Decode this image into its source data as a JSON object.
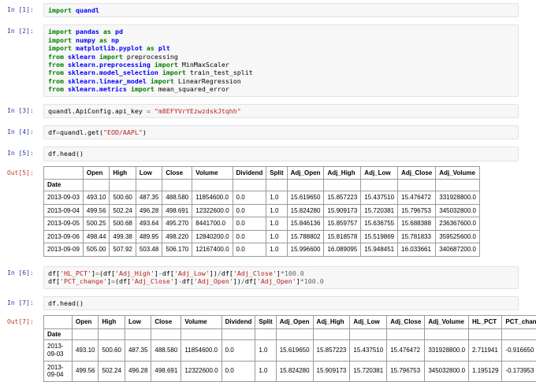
{
  "colors": {
    "in_prompt": "#303F9F",
    "out_prompt": "#C0392B",
    "keyword": "#008000",
    "module": "#0000FF",
    "string": "#BA2121",
    "operator": "#666666",
    "cell_background": "#F7F7F7",
    "table_border": "#9B9B9B"
  },
  "cells": [
    {
      "prompt": "In [1]:",
      "lines": [
        [
          [
            "k",
            "import"
          ],
          [
            "t",
            " "
          ],
          [
            "nn",
            "quandl"
          ]
        ]
      ]
    },
    {
      "prompt": "In [2]:",
      "lines": [
        [
          [
            "k",
            "import"
          ],
          [
            "t",
            " "
          ],
          [
            "nn",
            "pandas"
          ],
          [
            "t",
            " "
          ],
          [
            "k",
            "as"
          ],
          [
            "t",
            " "
          ],
          [
            "nn",
            "pd"
          ]
        ],
        [
          [
            "k",
            "import"
          ],
          [
            "t",
            " "
          ],
          [
            "nn",
            "numpy"
          ],
          [
            "t",
            " "
          ],
          [
            "k",
            "as"
          ],
          [
            "t",
            " "
          ],
          [
            "nn",
            "np"
          ]
        ],
        [
          [
            "k",
            "import"
          ],
          [
            "t",
            " "
          ],
          [
            "nn",
            "matplotlib.pyplot"
          ],
          [
            "t",
            " "
          ],
          [
            "k",
            "as"
          ],
          [
            "t",
            " "
          ],
          [
            "nn",
            "plt"
          ]
        ],
        [
          [
            "k",
            "from"
          ],
          [
            "t",
            " "
          ],
          [
            "nn",
            "sklearn"
          ],
          [
            "t",
            " "
          ],
          [
            "k",
            "import"
          ],
          [
            "t",
            " preprocessing"
          ]
        ],
        [
          [
            "k",
            "from"
          ],
          [
            "t",
            " "
          ],
          [
            "nn",
            "sklearn.preprocessing"
          ],
          [
            "t",
            " "
          ],
          [
            "k",
            "import"
          ],
          [
            "t",
            " MinMaxScaler"
          ]
        ],
        [
          [
            "k",
            "from"
          ],
          [
            "t",
            " "
          ],
          [
            "nn",
            "sklearn.model_selection"
          ],
          [
            "t",
            " "
          ],
          [
            "k",
            "import"
          ],
          [
            "t",
            " train_test_split"
          ]
        ],
        [
          [
            "k",
            "from"
          ],
          [
            "t",
            " "
          ],
          [
            "nn",
            "sklearn.linear_model"
          ],
          [
            "t",
            " "
          ],
          [
            "k",
            "import"
          ],
          [
            "t",
            " LinearRegression"
          ]
        ],
        [
          [
            "k",
            "from"
          ],
          [
            "t",
            " "
          ],
          [
            "nn",
            "sklearn.metrics"
          ],
          [
            "t",
            " "
          ],
          [
            "k",
            "import"
          ],
          [
            "t",
            " mean_squared_error"
          ]
        ]
      ]
    },
    {
      "prompt": "In [3]:",
      "lines": [
        [
          [
            "t",
            "quandl.ApiConfig.api_key "
          ],
          [
            "o",
            "="
          ],
          [
            "t",
            " "
          ],
          [
            "s",
            "\"m8EFYVrYEzwzdskJtqhh\""
          ]
        ]
      ]
    },
    {
      "prompt": "In [4]:",
      "lines": [
        [
          [
            "t",
            "df"
          ],
          [
            "o",
            "="
          ],
          [
            "t",
            "quandl.get("
          ],
          [
            "s",
            "\"EOD/AAPL\""
          ],
          [
            "t",
            ")"
          ]
        ]
      ]
    },
    {
      "prompt": "In [5]:",
      "lines": [
        [
          [
            "t",
            "df.head()"
          ]
        ]
      ]
    },
    {
      "prompt": "In [6]:",
      "lines": [
        [
          [
            "t",
            "df["
          ],
          [
            "s",
            "'HL_PCT'"
          ],
          [
            "t",
            "]"
          ],
          [
            "o",
            "="
          ],
          [
            "t",
            "(df["
          ],
          [
            "s",
            "'Adj_High'"
          ],
          [
            "t",
            "]"
          ],
          [
            "o",
            "-"
          ],
          [
            "t",
            "df["
          ],
          [
            "s",
            "'Adj_Low'"
          ],
          [
            "t",
            "])"
          ],
          [
            "o",
            "/"
          ],
          [
            "t",
            "df["
          ],
          [
            "s",
            "'Adj_Close'"
          ],
          [
            "t",
            "]"
          ],
          [
            "o",
            "*"
          ],
          [
            "m",
            "100.0"
          ]
        ],
        [
          [
            "t",
            "df["
          ],
          [
            "s",
            "'PCT_change'"
          ],
          [
            "t",
            "]"
          ],
          [
            "o",
            "="
          ],
          [
            "t",
            "(df["
          ],
          [
            "s",
            "'Adj_Close'"
          ],
          [
            "t",
            "]"
          ],
          [
            "o",
            "-"
          ],
          [
            "t",
            "df["
          ],
          [
            "s",
            "'Adj_Open'"
          ],
          [
            "t",
            "])"
          ],
          [
            "o",
            "/"
          ],
          [
            "t",
            "df["
          ],
          [
            "s",
            "'Adj_Open'"
          ],
          [
            "t",
            "]"
          ],
          [
            "o",
            "*"
          ],
          [
            "m",
            "100.0"
          ]
        ]
      ]
    },
    {
      "prompt": "In [7]:",
      "lines": [
        [
          [
            "t",
            "df.head()"
          ]
        ]
      ]
    }
  ],
  "outputs": {
    "out5": {
      "prompt": "Out[5]:",
      "index_name": "Date",
      "columns": [
        "Open",
        "High",
        "Low",
        "Close",
        "Volume",
        "Dividend",
        "Split",
        "Adj_Open",
        "Adj_High",
        "Adj_Low",
        "Adj_Close",
        "Adj_Volume"
      ],
      "rows": [
        [
          "2013-09-03",
          "493.10",
          "500.60",
          "487.35",
          "488.580",
          "11854600.0",
          "0.0",
          "1.0",
          "15.619650",
          "15.857223",
          "15.437510",
          "15.476472",
          "331928800.0"
        ],
        [
          "2013-09-04",
          "499.56",
          "502.24",
          "496.28",
          "498.691",
          "12322600.0",
          "0.0",
          "1.0",
          "15.824280",
          "15.909173",
          "15.720381",
          "15.796753",
          "345032800.0"
        ],
        [
          "2013-09-05",
          "500.25",
          "500.68",
          "493.64",
          "495.270",
          "8441700.0",
          "0.0",
          "1.0",
          "15.846136",
          "15.859757",
          "15.636755",
          "15.688388",
          "236367600.0"
        ],
        [
          "2013-09-06",
          "498.44",
          "499.38",
          "489.95",
          "498.220",
          "12840200.0",
          "0.0",
          "1.0",
          "15.788802",
          "15.818578",
          "15.519869",
          "15.781833",
          "359525600.0"
        ],
        [
          "2013-09-09",
          "505.00",
          "507.92",
          "503.48",
          "506.170",
          "12167400.0",
          "0.0",
          "1.0",
          "15.996600",
          "16.089095",
          "15.948451",
          "16.033661",
          "340687200.0"
        ]
      ]
    },
    "out7": {
      "prompt": "Out[7]:",
      "index_name": "Date",
      "columns": [
        "Open",
        "High",
        "Low",
        "Close",
        "Volume",
        "Dividend",
        "Split",
        "Adj_Open",
        "Adj_High",
        "Adj_Low",
        "Adj_Close",
        "Adj_Volume",
        "HL_PCT",
        "PCT_change"
      ],
      "rows": [
        [
          "2013-09-03",
          "493.10",
          "500.60",
          "487.35",
          "488.580",
          "11854600.0",
          "0.0",
          "1.0",
          "15.619650",
          "15.857223",
          "15.437510",
          "15.476472",
          "331928800.0",
          "2.711941",
          "-0.916650"
        ],
        [
          "2013-09-04",
          "499.56",
          "502.24",
          "496.28",
          "498.691",
          "12322600.0",
          "0.0",
          "1.0",
          "15.824280",
          "15.909173",
          "15.720381",
          "15.796753",
          "345032800.0",
          "1.195129",
          "-0.173953"
        ]
      ]
    }
  }
}
